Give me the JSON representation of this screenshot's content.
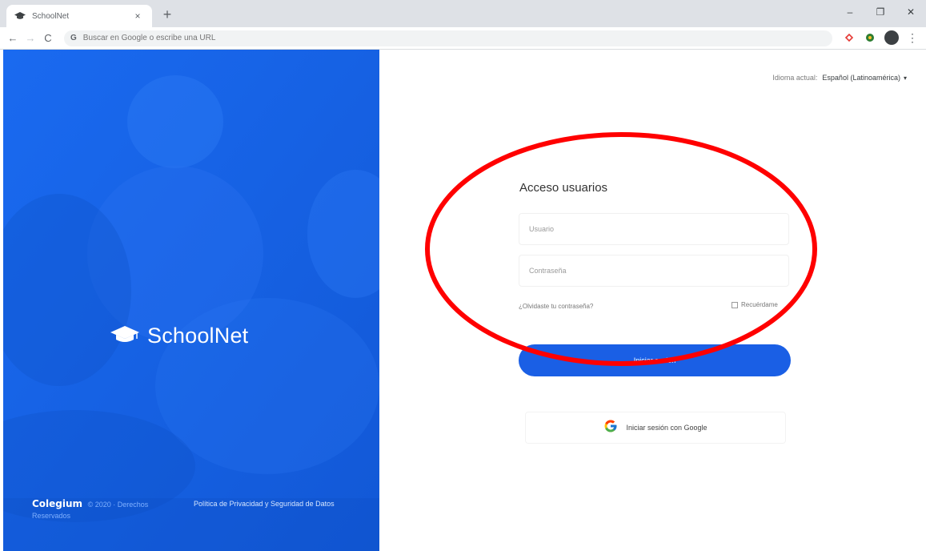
{
  "browser": {
    "tab_title": "SchoolNet",
    "tab_close": "×",
    "new_tab": "+",
    "omnibox_placeholder": "Buscar en Google o escribe una URL",
    "omnibox_prefix": "G",
    "win_minimize": "–",
    "win_restore": "❐",
    "win_close": "✕"
  },
  "hero": {
    "brand_name": "SchoolNet",
    "footer_company": "Colegium",
    "footer_copyright": "© 2020 · Derechos Reservados",
    "footer_privacy": "Política de Privacidad y Seguridad de Datos",
    "background_color": "#1565e8"
  },
  "header": {
    "language_label": "Idioma actual:",
    "language_value": "Español (Latinoamérica)",
    "language_caret": "▾"
  },
  "login": {
    "title": "Acceso usuarios",
    "username_placeholder": "Usuario",
    "password_placeholder": "Contraseña",
    "forgot_password": "¿Olvidaste tu contraseña?",
    "remember_me": "Recuérdame",
    "submit_label": "Iniciar sesión",
    "google_label": "Iniciar sesión con Google",
    "accent_color": "#1a5fe5"
  },
  "annotation": {
    "color": "#ff0000",
    "shape": "ellipse"
  },
  "icons": {
    "back": "←",
    "forward": "→",
    "reload": "C",
    "kebab": "⋮"
  }
}
